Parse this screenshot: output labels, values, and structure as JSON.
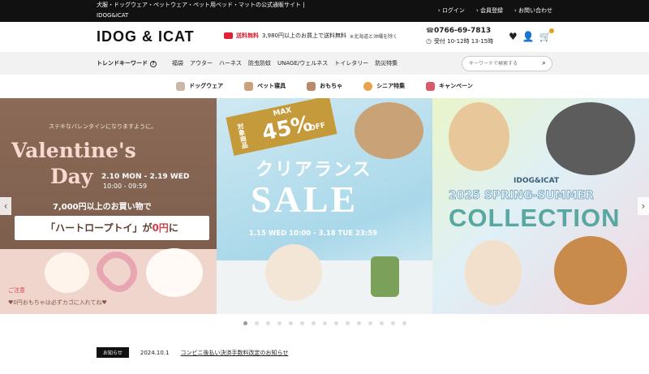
{
  "topbar": {
    "description": "犬服・ドッグウェア・ペットウェア・ペット用ベッド・マットの公式通販サイト |",
    "site_name": "IDOG&ICAT",
    "links": [
      "ログイン",
      "会員登録",
      "お問い合わせ"
    ]
  },
  "header": {
    "logo": "IDOG & ICAT",
    "shipping_label": "送料無料",
    "shipping_text": "3,980円以上のお買上で送料無料",
    "shipping_note": "※北海道と沖縄を除く",
    "phone": "0766-69-7813",
    "hours": "受付 10-12時 13-15時",
    "icons": [
      "heart-icon",
      "user-icon",
      "cart-icon"
    ]
  },
  "nav": {
    "trend_label": "トレンドキーワード",
    "trend_help": "?",
    "items": [
      "福袋",
      "アウター",
      "ハーネス",
      "防虫防蚊",
      "UNAGE/ウェルネス",
      "トイレタリー",
      "防災特集"
    ],
    "search_placeholder": "キーワードで検索する"
  },
  "categories": [
    {
      "label": "ドッグウェア",
      "color": "#c9b8a8"
    },
    {
      "label": "ペット寝具",
      "color": "#c9a27c"
    },
    {
      "label": "おもちゃ",
      "color": "#b98a6c"
    },
    {
      "label": "シニア特集",
      "color": "#e8a24a"
    },
    {
      "label": "キャンペーン",
      "color": "#d55a6a"
    }
  ],
  "slides": {
    "valentine": {
      "lead": "ステキなバレンタインになりますように。",
      "title_line1": "Valentine's",
      "title_line2": "Day",
      "dates": "2.10 MON - 2.19 WED",
      "times": "10:00 - 09:59",
      "buy": "7,000円以上のお買い物で",
      "ribbon_prefix": "「ハートロープトイ」が",
      "ribbon_free": "0円",
      "ribbon_suffix": "に",
      "sticker": "ご注意",
      "note": "♥0円おもちゃは必ずカゴに入れてね♥"
    },
    "sale": {
      "target": "対象商品",
      "max": "MAX",
      "percent": "45%",
      "off": "OFF",
      "clearance": "クリアランス",
      "sale": "SALE",
      "period": "1.15 WED 10:00 - 3.18 TUE 23:59"
    },
    "collection": {
      "brand": "IDOG&ICAT",
      "season": "2025 SPRING-SUMMER",
      "title": "COLLECTION"
    }
  },
  "slider": {
    "dot_count": 15,
    "active_index": 0
  },
  "news": {
    "tag": "お知らせ",
    "date": "2024.10.1",
    "title": "コンビニ後払い決済手数料改定のお知らせ"
  },
  "colors": {
    "topbar": "#111111",
    "sale_badge": "#c59a3a",
    "accent_red": "#dd2233"
  }
}
